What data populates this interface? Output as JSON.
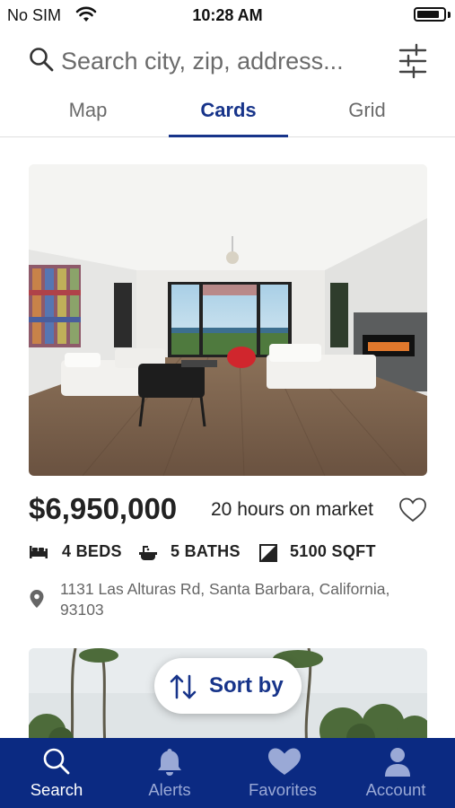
{
  "status_bar": {
    "carrier": "No SIM",
    "time": "10:28 AM",
    "battery_level": 0.85
  },
  "search": {
    "placeholder": "Search city, zip, address...",
    "value": ""
  },
  "tabs": [
    {
      "label": "Map",
      "active": false
    },
    {
      "label": "Cards",
      "active": true
    },
    {
      "label": "Grid",
      "active": false
    }
  ],
  "listing": {
    "price": "$6,950,000",
    "time_on_market": "20 hours on market",
    "beds": "4 BEDS",
    "baths": "5 BATHS",
    "sqft": "5100 SQFT",
    "address": "1131 Las Alturas Rd, Santa Barbara, California, 93103"
  },
  "sort": {
    "label": "Sort by"
  },
  "bottom_nav": [
    {
      "label": "Search",
      "icon": "search-icon",
      "active": true
    },
    {
      "label": "Alerts",
      "icon": "bell-icon",
      "active": false
    },
    {
      "label": "Favorites",
      "icon": "heart-icon",
      "active": false
    },
    {
      "label": "Account",
      "icon": "person-icon",
      "active": false
    }
  ],
  "colors": {
    "accent": "#17348a",
    "nav_background": "#0b2a82",
    "nav_inactive": "#9aa9d6"
  }
}
